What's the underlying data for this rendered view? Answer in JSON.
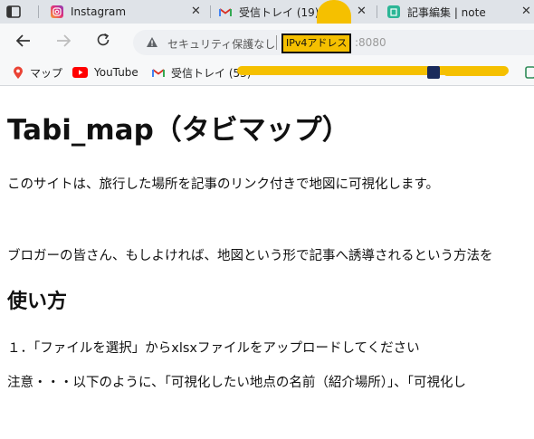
{
  "tabs": [
    {
      "title": "Instagram",
      "icon": "instagram-icon"
    },
    {
      "title": "受信トレイ (19) -",
      "icon": "gmail-icon"
    },
    {
      "title": "記事編集 | note",
      "icon": "note-icon"
    }
  ],
  "address_bar": {
    "security_text": "セキュリティ保護なし",
    "host": "IPv4アドレス",
    "port": ":8080"
  },
  "bookmarks": [
    {
      "label": "マップ",
      "icon": "maps-pin-icon"
    },
    {
      "label": "YouTube",
      "icon": "youtube-icon"
    },
    {
      "label": "受信トレイ (53)",
      "icon": "gmail-icon"
    }
  ],
  "page": {
    "title": "Tabi_map（タビマップ）",
    "intro": "このサイトは、旅行した場所を記事のリンク付きで地図に可視化します。",
    "bloggers": "ブロガーの皆さん、もしよければ、地図という形で記事へ誘導されるという方法を",
    "usage_heading": "使い方",
    "step1": "１．「ファイルを選択」からxlsxファイルをアップロードしてください",
    "note": "注意・・・以下のように、「可視化したい地点の名前（紹介場所）」、「可視化し"
  },
  "colors": {
    "highlight": "#f5c000",
    "tabstrip": "#dfe3e8",
    "toolbar": "#f7f8f9"
  }
}
